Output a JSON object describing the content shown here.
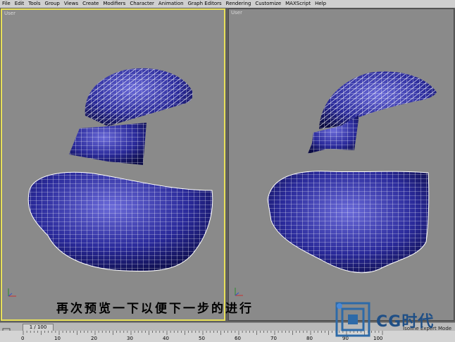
{
  "menu": [
    "File",
    "Edit",
    "Tools",
    "Group",
    "Views",
    "Create",
    "Modifiers",
    "Character",
    "Animation",
    "Graph Editors",
    "Rendering",
    "Customize",
    "MAXScript",
    "Help"
  ],
  "viewports": {
    "left_label": "User",
    "right_label": "User"
  },
  "caption": "再次预览一下以便下一步的进行",
  "timeslider": {
    "position": "1 / 100"
  },
  "ruler_ticks": [
    "0",
    "10",
    "20",
    "30",
    "40",
    "50",
    "60",
    "70",
    "80",
    "90",
    "100"
  ],
  "status_text": "Isoline Expert Mode",
  "watermark": {
    "text": "CG时代"
  },
  "colors": {
    "mesh_fill": "#2a2a9a",
    "wire": "#ffffff",
    "viewport_bg": "#8a8a8a",
    "active_border": "#e8e05a"
  }
}
